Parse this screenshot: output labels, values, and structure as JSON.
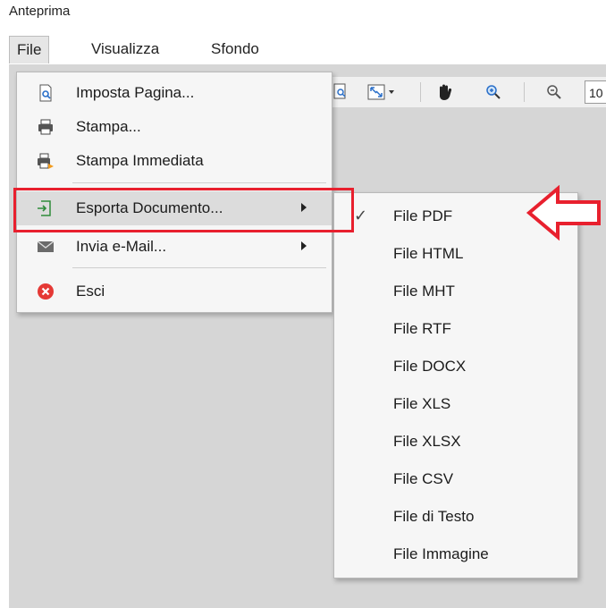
{
  "window": {
    "title": "Anteprima"
  },
  "menubar": {
    "items": [
      {
        "label": "File"
      },
      {
        "label": "Visualizza"
      },
      {
        "label": "Sfondo"
      }
    ]
  },
  "toolbar": {
    "zoom_value": "10"
  },
  "file_menu": {
    "items": [
      {
        "label": "Imposta Pagina...",
        "icon": "page-setup-icon"
      },
      {
        "label": "Stampa...",
        "icon": "printer-icon"
      },
      {
        "label": "Stampa Immediata",
        "icon": "quick-print-icon"
      },
      {
        "label": "Esporta Documento...",
        "icon": "export-icon",
        "has_submenu": true,
        "highlighted": true
      },
      {
        "label": "Invia e-Mail...",
        "icon": "envelope-icon",
        "has_submenu": true
      },
      {
        "label": "Esci",
        "icon": "exit-icon"
      }
    ]
  },
  "export_submenu": {
    "items": [
      {
        "label": "File PDF",
        "checked": true
      },
      {
        "label": "File HTML"
      },
      {
        "label": "File MHT"
      },
      {
        "label": "File RTF"
      },
      {
        "label": "File DOCX"
      },
      {
        "label": "File XLS"
      },
      {
        "label": "File XLSX"
      },
      {
        "label": "File CSV"
      },
      {
        "label": "File di Testo"
      },
      {
        "label": "File Immagine"
      }
    ]
  },
  "colors": {
    "annotation_red": "#e8202e",
    "menu_bg": "#f6f6f6",
    "workarea": "#d6d6d6",
    "exit_red": "#e53935"
  }
}
